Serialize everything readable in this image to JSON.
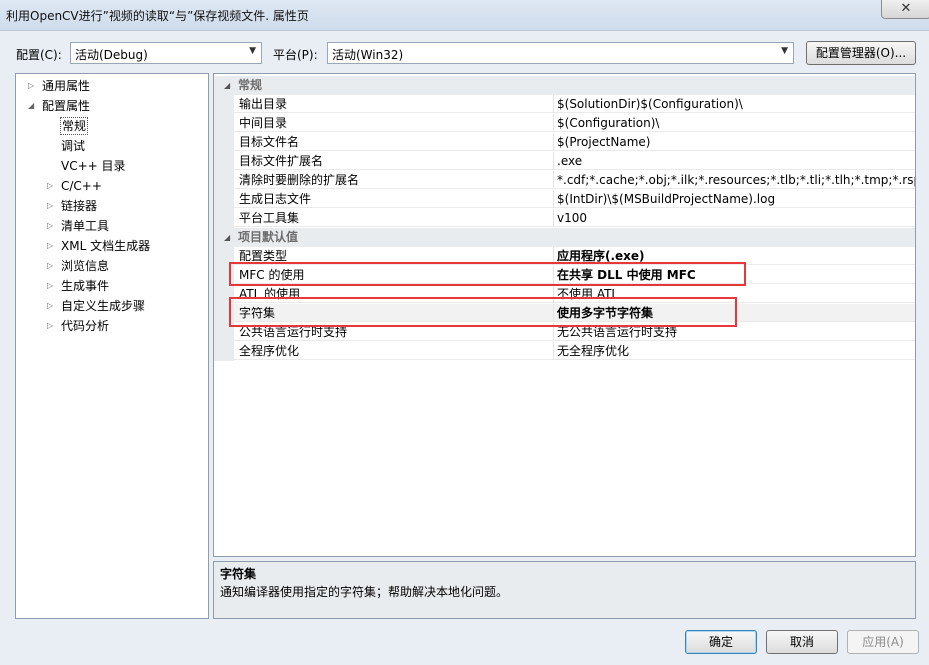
{
  "window": {
    "title": "利用OpenCV进行”视频的读取“与”保存视频文件. 属性页",
    "close_glyph": "✕"
  },
  "toolbar": {
    "config_label": "配置(C):",
    "config_value": "活动(Debug)",
    "platform_label": "平台(P):",
    "platform_value": "活动(Win32)",
    "manager_button": "配置管理器(O)...",
    "dropdown_glyph": "▼"
  },
  "tree": {
    "collapsed_glyph": "▷",
    "expanded_glyph": "◢",
    "items": [
      {
        "label": "通用属性"
      },
      {
        "label": "配置属性"
      },
      {
        "label": "常规"
      },
      {
        "label": "调试"
      },
      {
        "label": "VC++ 目录"
      },
      {
        "label": "C/C++"
      },
      {
        "label": "链接器"
      },
      {
        "label": "清单工具"
      },
      {
        "label": "XML 文档生成器"
      },
      {
        "label": "浏览信息"
      },
      {
        "label": "生成事件"
      },
      {
        "label": "自定义生成步骤"
      },
      {
        "label": "代码分析"
      }
    ]
  },
  "grid": {
    "categories": [
      {
        "label": "常规",
        "rows": [
          {
            "name": "输出目录",
            "value": "$(SolutionDir)$(Configuration)\\"
          },
          {
            "name": "中间目录",
            "value": "$(Configuration)\\"
          },
          {
            "name": "目标文件名",
            "value": "$(ProjectName)"
          },
          {
            "name": "目标文件扩展名",
            "value": ".exe"
          },
          {
            "name": "清除时要删除的扩展名",
            "value": "*.cdf;*.cache;*.obj;*.ilk;*.resources;*.tlb;*.tli;*.tlh;*.tmp;*.rsp;*.pgc"
          },
          {
            "name": "生成日志文件",
            "value": "$(IntDir)\\$(MSBuildProjectName).log"
          },
          {
            "name": "平台工具集",
            "value": "v100"
          }
        ]
      },
      {
        "label": "项目默认值",
        "rows": [
          {
            "name": "配置类型",
            "value": "应用程序(.exe)"
          },
          {
            "name": "MFC 的使用",
            "value": "在共享 DLL 中使用 MFC"
          },
          {
            "name": "ATL 的使用",
            "value": "不使用 ATL"
          },
          {
            "name": "字符集",
            "value": "使用多字节字符集"
          },
          {
            "name": "公共语言运行时支持",
            "value": "无公共语言运行时支持"
          },
          {
            "name": "全程序优化",
            "value": "无全程序优化"
          }
        ]
      }
    ]
  },
  "description": {
    "title": "字符集",
    "text": "通知编译器使用指定的字符集；帮助解决本地化问题。"
  },
  "buttons": {
    "ok": "确定",
    "cancel": "取消",
    "apply": "应用(A)"
  },
  "colors": {
    "highlight_box": "#e8373c",
    "background": "#e9eef5"
  }
}
